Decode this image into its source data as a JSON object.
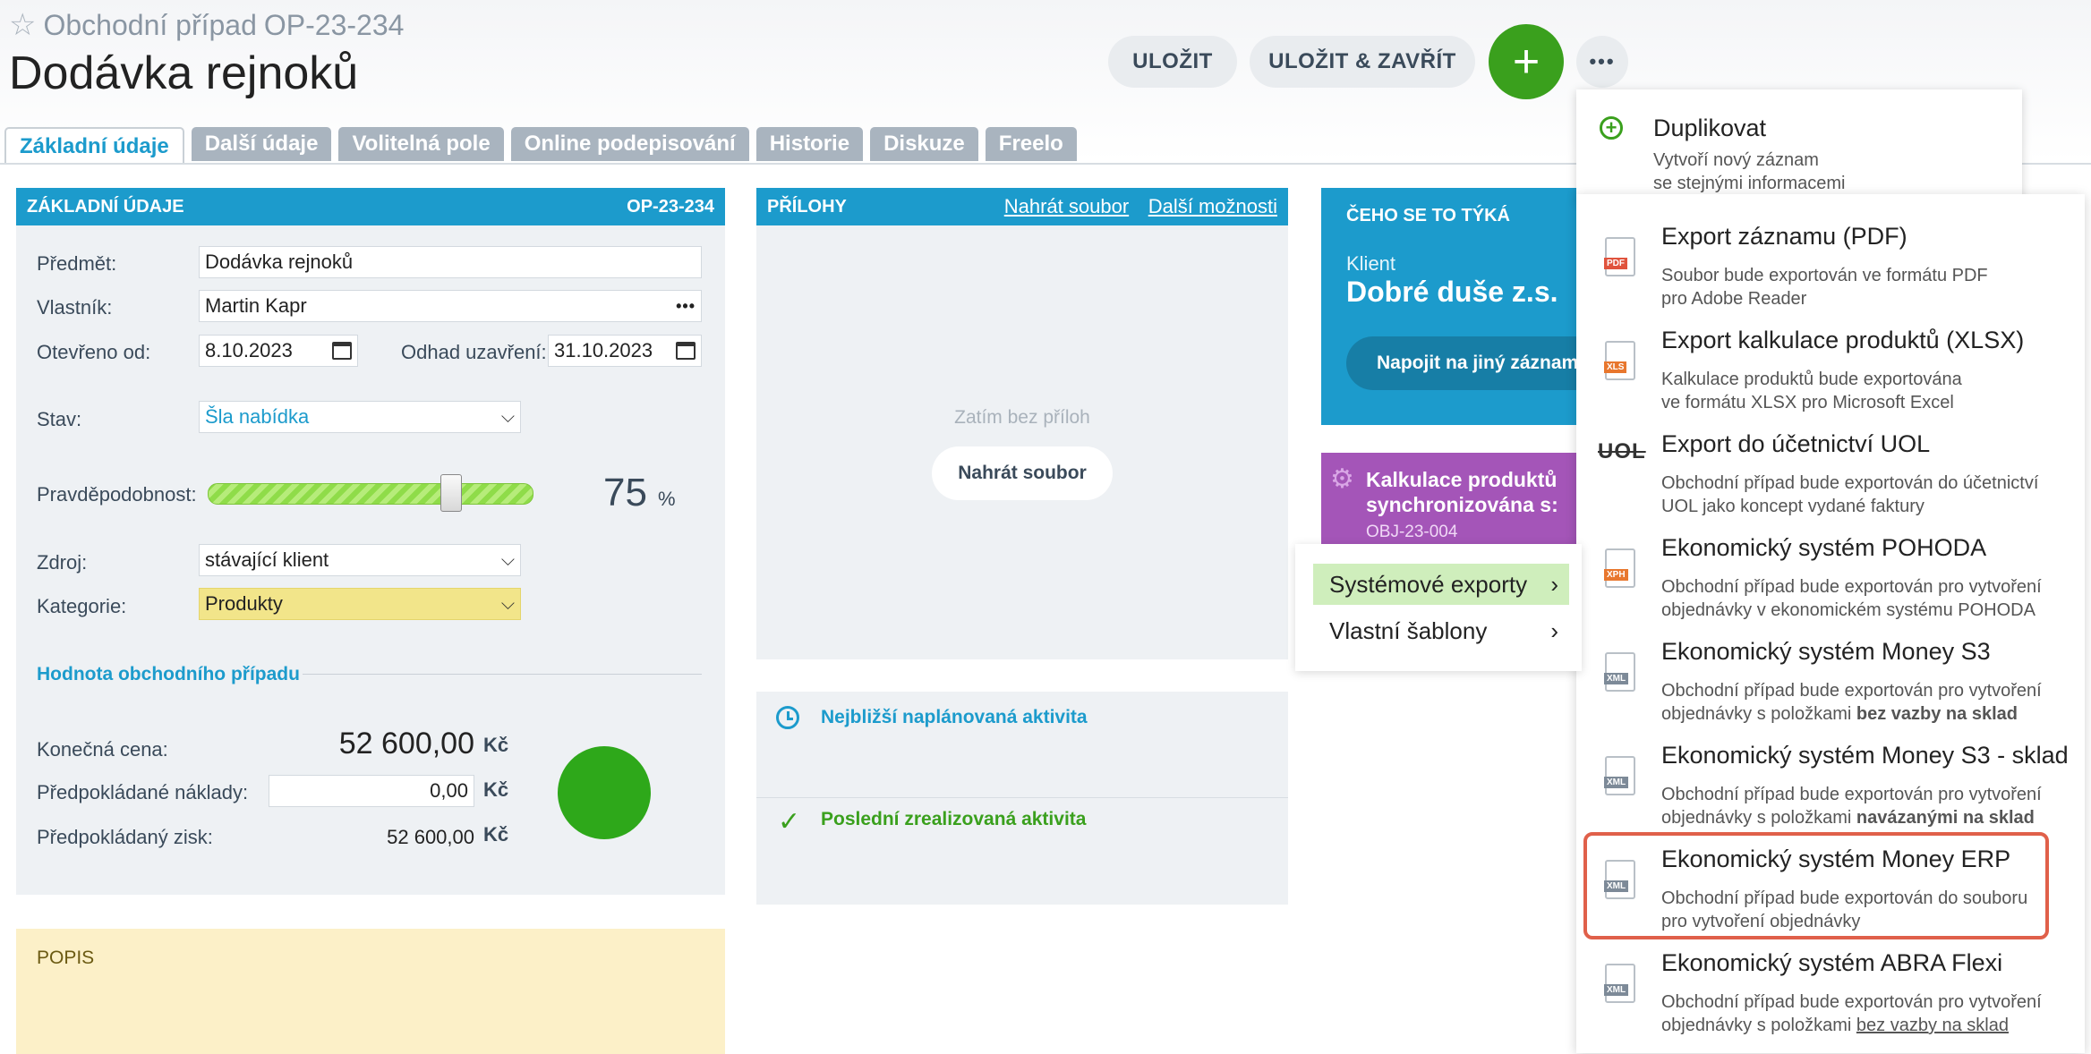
{
  "header": {
    "breadcrumb_type": "Obchodní případ",
    "breadcrumb_code": "OP-23-234",
    "title": "Dodávka rejnoků",
    "save_label": "ULOŽIT",
    "save_close_label": "ULOŽIT & ZAVŘÍT",
    "add_symbol": "+",
    "more_symbol": "•••"
  },
  "tabs": [
    "Základní údaje",
    "Další údaje",
    "Volitelná pole",
    "Online podepisování",
    "Historie",
    "Diskuze",
    "Freelo"
  ],
  "basic": {
    "header": "ZÁKLADNÍ ÚDAJE",
    "code": "OP-23-234",
    "subject_label": "Předmět:",
    "subject_value": "Dodávka rejnoků",
    "owner_label": "Vlastník:",
    "owner_value": "Martin Kapr",
    "opened_label": "Otevřeno od:",
    "opened_value": "8.10.2023",
    "close_label": "Odhad uzavření:",
    "close_value": "31.10.2023",
    "state_label": "Stav:",
    "state_value": "Šla nabídka",
    "probability_label": "Pravděpodobnost:",
    "probability_value": "75",
    "probability_unit": "%",
    "probability_fraction": 0.75,
    "source_label": "Zdroj:",
    "source_value": "stávající klient",
    "category_label": "Kategorie:",
    "category_value": "Produkty",
    "value_section": "Hodnota obchodního případu",
    "final_price_label": "Konečná cena:",
    "final_price_value": "52 600,00",
    "expected_cost_label": "Předpokládané náklady:",
    "expected_cost_value": "0,00",
    "expected_profit_label": "Předpokládaný zisk:",
    "expected_profit_value": "52 600,00",
    "currency": "Kč"
  },
  "description": {
    "header": "POPIS"
  },
  "attachments": {
    "header": "PŘÍLOHY",
    "upload_link": "Nahrát soubor",
    "more_link": "Další možnosti",
    "empty_text": "Zatím bez příloh",
    "upload_button": "Nahrát soubor"
  },
  "activities": {
    "next_planned": "Nejbližší naplánovaná aktivita",
    "last_done": "Poslední zrealizovaná aktivita"
  },
  "related": {
    "header": "ČEHO SE TO TÝKÁ",
    "client_label": "Klient",
    "client_name": "Dobré duše z.s.",
    "connect_button": "Napojit na jiný záznam"
  },
  "sync": {
    "title_line1": "Kalkulace produktů",
    "title_line2": "synchronizována s:",
    "order_code": "OBJ-23-004"
  },
  "dup_menu": {
    "title": "Duplikovat",
    "desc_line1": "Vytvoří nový záznam",
    "desc_line2": "se stejnými informacemi"
  },
  "submenu": {
    "system_exports": "Systémové exporty",
    "custom_templates": "Vlastní šablony",
    "arrow": "›"
  },
  "exports": [
    {
      "icon": "pdf-file-icon",
      "tag": "PDF",
      "title": "Export záznamu (PDF)",
      "desc1": "Soubor bude exportován ve formátu PDF",
      "desc2": "pro Adobe Reader"
    },
    {
      "icon": "xls-file-icon",
      "tag": "XLS",
      "title": "Export kalkulace produktů (XLSX)",
      "desc1": "Kalkulace produktů bude exportována",
      "desc2": "ve formátu XLSX pro Microsoft Excel"
    },
    {
      "icon": "uol-logo-icon",
      "tag": "UOL",
      "title": "Export do účetnictví UOL",
      "desc1": "Obchodní případ bude exportován do účetnictví",
      "desc2": "UOL jako koncept vydané faktury"
    },
    {
      "icon": "xph-file-icon",
      "tag": "XPH",
      "title": "Ekonomický systém POHODA",
      "desc1": "Obchodní případ bude exportován pro vytvoření",
      "desc2": "objednávky v ekonomickém systému POHODA"
    },
    {
      "icon": "xml-file-icon",
      "tag": "XML",
      "title": "Ekonomický systém Money S3",
      "desc1": "Obchodní případ bude exportován pro vytvoření",
      "desc2a": "objednávky s položkami ",
      "desc2b": "bez vazby na sklad"
    },
    {
      "icon": "xml-file-icon",
      "tag": "XML",
      "title": "Ekonomický systém Money S3 - sklad",
      "desc1": "Obchodní případ bude exportován pro vytvoření",
      "desc2a": "objednávky s položkami ",
      "desc2b": "navázanými na sklad"
    },
    {
      "icon": "xml-file-icon",
      "tag": "XML",
      "title": "Ekonomický systém Money ERP",
      "desc1": "Obchodní případ bude exportován do souboru",
      "desc2": "pro vytvoření objednávky"
    },
    {
      "icon": "xml-file-icon",
      "tag": "XML",
      "title": "Ekonomický systém ABRA Flexi",
      "desc1": "Obchodní případ bude exportován pro vytvoření",
      "desc2a": "objednávky s položkami ",
      "desc2b": "bez vazby na sklad"
    }
  ],
  "colors": {
    "accent": "#1c9bcc",
    "green": "#3aa01d",
    "purple": "#a455b8",
    "highlight_border": "#e0604a"
  }
}
